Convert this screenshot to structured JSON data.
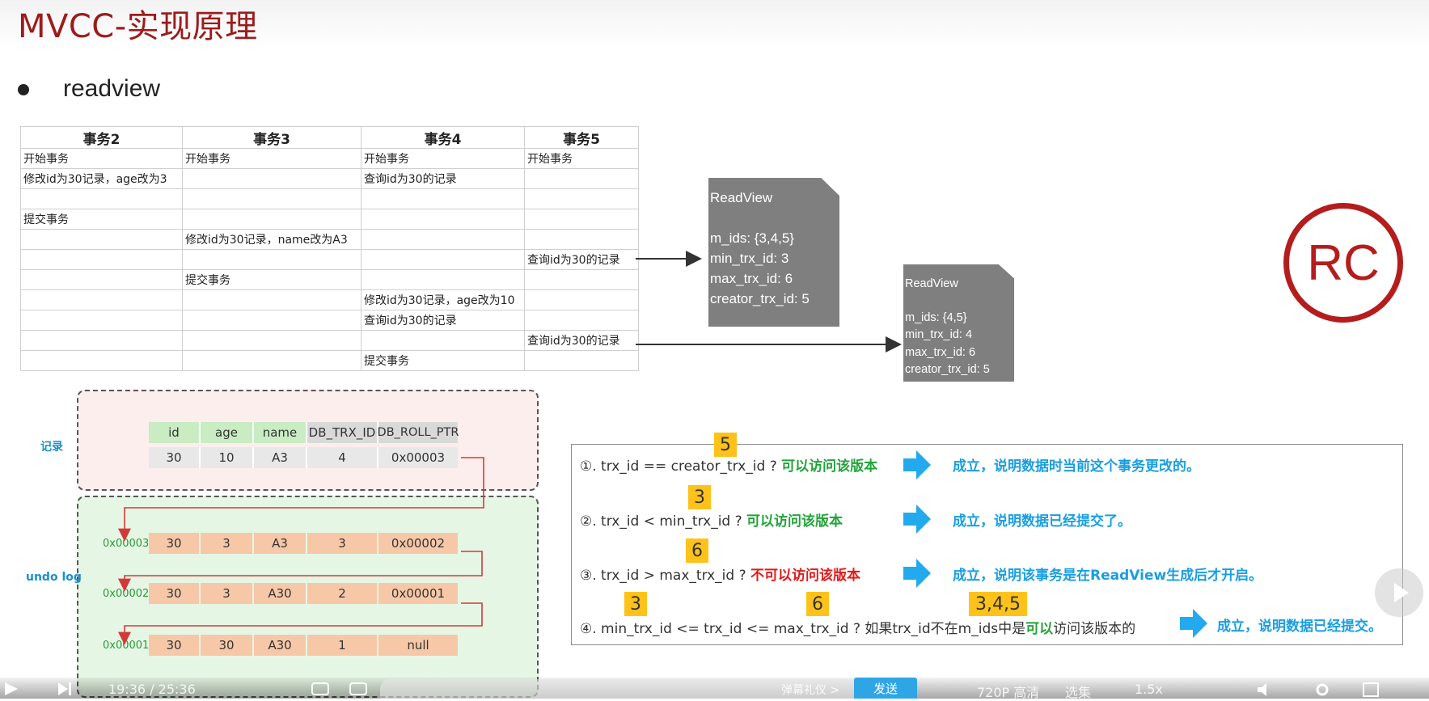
{
  "slide": {
    "title": "MVCC-实现原理",
    "heading": "readview"
  },
  "txn_table": {
    "headers": [
      "事务2",
      "事务3",
      "事务4",
      "事务5"
    ],
    "rows": [
      [
        "开始事务",
        "开始事务",
        "开始事务",
        "开始事务"
      ],
      [
        "修改id为30记录，age改为3",
        "",
        "查询id为30的记录",
        ""
      ],
      [
        "",
        "",
        "",
        ""
      ],
      [
        "提交事务",
        "",
        "",
        ""
      ],
      [
        "",
        "修改id为30记录，name改为A3",
        "",
        ""
      ],
      [
        "",
        "",
        "",
        "查询id为30的记录"
      ],
      [
        "",
        "提交事务",
        "",
        ""
      ],
      [
        "",
        "",
        "修改id为30记录，age改为10",
        ""
      ],
      [
        "",
        "",
        "查询id为30的记录",
        ""
      ],
      [
        "",
        "",
        "",
        "查询id为30的记录"
      ],
      [
        "",
        "",
        "提交事务",
        ""
      ]
    ]
  },
  "readview1": {
    "title": "ReadView",
    "m_ids": "m_ids: {3,4,5}",
    "min": "min_trx_id: 3",
    "max": "max_trx_id: 6",
    "creator": "creator_trx_id: 5"
  },
  "readview2": {
    "title": "ReadView",
    "m_ids": "m_ids: {4,5}",
    "min": "min_trx_id: 4",
    "max": "max_trx_id: 6",
    "creator": "creator_trx_id: 5"
  },
  "rc_badge": "RC",
  "record": {
    "label": "记录",
    "headers": [
      "id",
      "age",
      "name",
      "DB_TRX_ID",
      "DB_ROLL_PTR"
    ],
    "values": [
      "30",
      "10",
      "A3",
      "4",
      "0x00003"
    ]
  },
  "undo": {
    "label": "undo log",
    "rows": [
      {
        "addr": "0x00003",
        "values": [
          "30",
          "3",
          "A3",
          "3",
          "0x00002"
        ]
      },
      {
        "addr": "0x00002",
        "values": [
          "30",
          "3",
          "A30",
          "2",
          "0x00001"
        ]
      },
      {
        "addr": "0x00001",
        "values": [
          "30",
          "30",
          "A30",
          "1",
          "null"
        ]
      }
    ]
  },
  "rules": {
    "r1": {
      "text": "①. trx_id  == creator_trx_id ?",
      "verdict": "可以访问该版本",
      "result": "成立，说明数据时当前这个事务更改的。",
      "tag": "5"
    },
    "r2": {
      "text": "②. trx_id < min_trx_id ?",
      "verdict": "可以访问该版本",
      "result": "成立，说明数据已经提交了。",
      "tag": "3"
    },
    "r3": {
      "text": "③. trx_id > max_trx_id ?",
      "verdict": "不可以访问该版本",
      "result": "成立，说明该事务是在ReadView生成后才开启。",
      "tag": "6"
    },
    "r4": {
      "text": "④. min_trx_id <= trx_id <= max_trx_id ?  如果trx_id不在m_ids中是",
      "verdict": "可以",
      "text_tail": "访问该版本的",
      "result": "成立，说明数据已经提交。",
      "tag_a": "3",
      "tag_b": "6",
      "tag_c": "3,4,5"
    }
  },
  "player": {
    "time": "19:36 / 25:36",
    "send_label": "发送",
    "quality": "720P 高清",
    "episodes": "选集",
    "speed": "1.5x",
    "danmaku_hint": "弹幕礼仪 >"
  },
  "colors": {
    "title": "#9b1c1c",
    "rc": "#b51d1d",
    "readview_bg": "#7f7f7f",
    "accept": "#22a33a",
    "reject": "#e01a1a",
    "result": "#1a9ee0",
    "tag": "#ffc21a"
  }
}
